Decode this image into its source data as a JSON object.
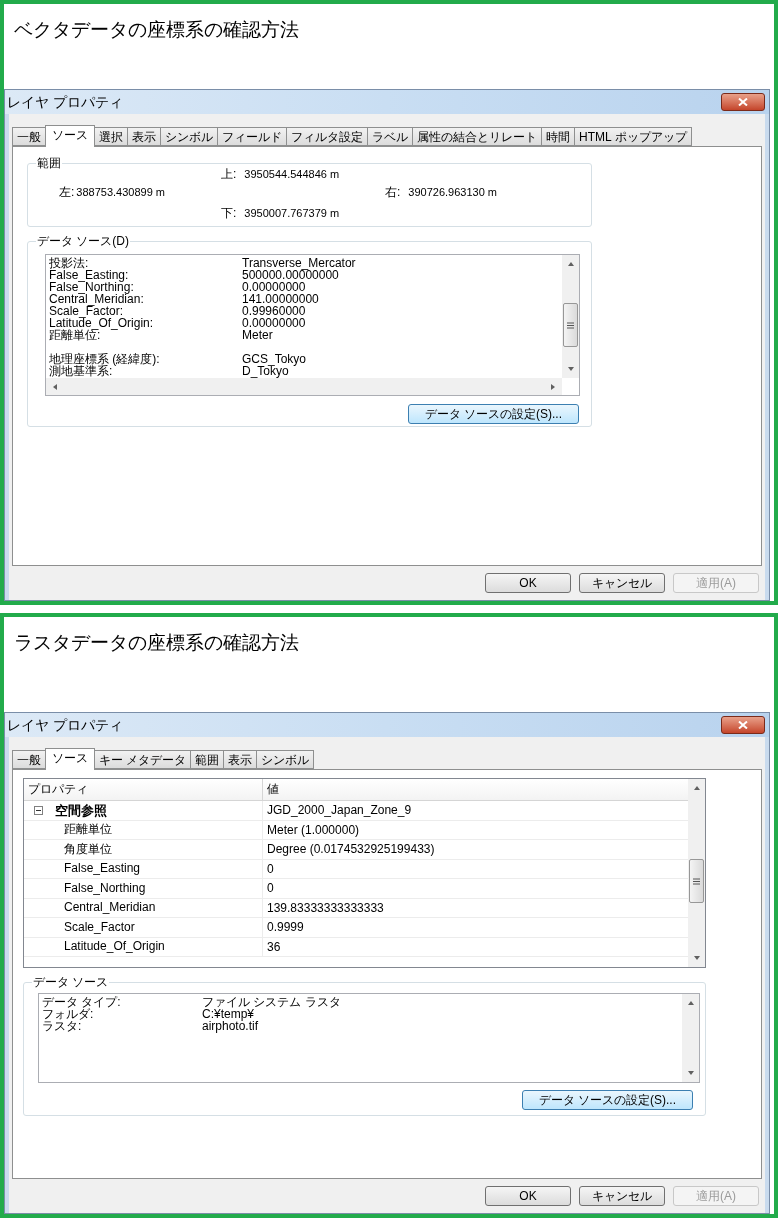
{
  "sections": [
    {
      "kind": "vector",
      "heading": "ベクタデータの座標系の確認方法",
      "dialog": {
        "title": "レイヤ プロパティ",
        "tabs": [
          {
            "label": "一般",
            "selected": false
          },
          {
            "label": "ソース",
            "selected": true
          },
          {
            "label": "選択",
            "selected": false
          },
          {
            "label": "表示",
            "selected": false
          },
          {
            "label": "シンボル",
            "selected": false
          },
          {
            "label": "フィールド",
            "selected": false
          },
          {
            "label": "フィルタ設定",
            "selected": false
          },
          {
            "label": "ラベル",
            "selected": false
          },
          {
            "label": "属性の結合とリレート",
            "selected": false
          },
          {
            "label": "時間",
            "selected": false
          },
          {
            "label": "HTML ポップアップ",
            "selected": false
          }
        ],
        "extent": {
          "legend": "範囲",
          "top_label": "上:",
          "top": "3950544.544846 m",
          "left_label": "左:",
          "left": "388753.430899 m",
          "right_label": "右:",
          "right": "390726.963130 m",
          "bottom_label": "下:",
          "bottom": "3950007.767379 m"
        },
        "data_source": {
          "legend": "データ ソース(D)",
          "groups": [
            [
              {
                "label": "投影法:",
                "value": "Transverse_Mercator"
              },
              {
                "label": "False_Easting:",
                "value": "500000.00000000"
              },
              {
                "label": "False_Northing:",
                "value": "0.00000000"
              },
              {
                "label": "Central_Meridian:",
                "value": "141.00000000"
              },
              {
                "label": "Scale_Factor:",
                "value": "0.99960000"
              },
              {
                "label": "Latitude_Of_Origin:",
                "value": "0.00000000"
              },
              {
                "label": "距離単位:",
                "value": "Meter"
              }
            ],
            [
              {
                "label": "地理座標系 (経緯度):",
                "value": "GCS_Tokyo"
              },
              {
                "label": "測地基準系:",
                "value": "D_Tokyo"
              }
            ]
          ],
          "button": "データ ソースの設定(S)..."
        },
        "buttons": [
          {
            "label": "OK",
            "disabled": false
          },
          {
            "label": "キャンセル",
            "disabled": false
          },
          {
            "label": "適用(A)",
            "disabled": true
          }
        ]
      }
    },
    {
      "kind": "raster",
      "heading": "ラスタデータの座標系の確認方法",
      "dialog": {
        "title": "レイヤ プロパティ",
        "tabs": [
          {
            "label": "一般",
            "selected": false
          },
          {
            "label": "ソース",
            "selected": true
          },
          {
            "label": "キー メタデータ",
            "selected": false
          },
          {
            "label": "範囲",
            "selected": false
          },
          {
            "label": "表示",
            "selected": false
          },
          {
            "label": "シンボル",
            "selected": false
          }
        ],
        "property_grid": {
          "columns": [
            "プロパティ",
            "値"
          ],
          "rows": [
            {
              "kind": "group",
              "label": "空間参照",
              "value": "JGD_2000_Japan_Zone_9",
              "expanded": true
            },
            {
              "kind": "item",
              "label": "距離単位",
              "value": "Meter (1.000000)"
            },
            {
              "kind": "item",
              "label": "角度単位",
              "value": "Degree (0.0174532925199433)"
            },
            {
              "kind": "item",
              "label": "False_Easting",
              "value": "0"
            },
            {
              "kind": "item",
              "label": "False_Northing",
              "value": "0"
            },
            {
              "kind": "item",
              "label": "Central_Meridian",
              "value": "139.83333333333333"
            },
            {
              "kind": "item",
              "label": "Scale_Factor",
              "value": "0.9999"
            },
            {
              "kind": "item",
              "label": "Latitude_Of_Origin",
              "value": "36"
            }
          ]
        },
        "data_source": {
          "legend": "データ ソース",
          "groups": [
            [
              {
                "label": "データ タイプ:",
                "value": "ファイル システム ラスタ"
              },
              {
                "label": "フォルダ:",
                "value": "C:¥temp¥"
              },
              {
                "label": "ラスタ:",
                "value": "airphoto.tif"
              }
            ]
          ],
          "button": "データ ソースの設定(S)..."
        },
        "buttons": [
          {
            "label": "OK",
            "disabled": false
          },
          {
            "label": "キャンセル",
            "disabled": false
          },
          {
            "label": "適用(A)",
            "disabled": true
          }
        ]
      }
    }
  ]
}
